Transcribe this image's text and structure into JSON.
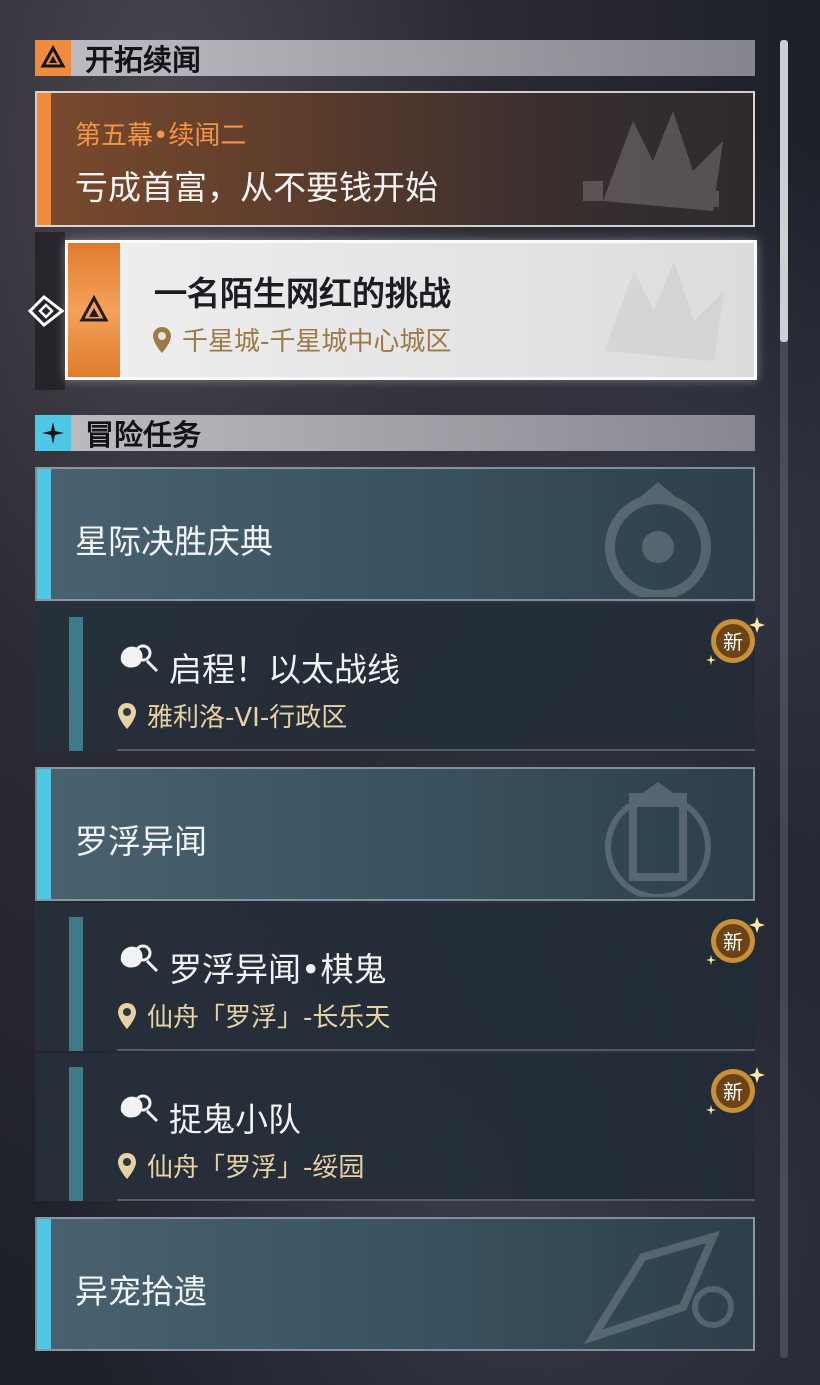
{
  "sections": {
    "trailblaze": {
      "title": "开拓续闻",
      "icon": "trailblaze-icon"
    },
    "adventure": {
      "title": "冒险任务",
      "icon": "adventure-icon"
    }
  },
  "trailblaze_card": {
    "subtitle": "第五幕•续闻二",
    "title": "亏成首富，从不要钱开始"
  },
  "trailblaze_quest": {
    "title": "一名陌生网红的挑战",
    "location": "千星城-千星城中心城区",
    "selected": true
  },
  "groups": [
    {
      "title": "星际决胜庆典"
    },
    {
      "title": "罗浮异闻"
    },
    {
      "title": "异宠拾遗"
    }
  ],
  "quests": [
    {
      "title": "启程！以太战线",
      "location": "雅利洛-VI-行政区",
      "badge": "新"
    },
    {
      "title": "罗浮异闻•棋鬼",
      "location": "仙舟「罗浮」-长乐天",
      "badge": "新"
    },
    {
      "title": "捉鬼小队",
      "location": "仙舟「罗浮」-绥园",
      "badge": "新"
    }
  ],
  "colors": {
    "trailblaze_accent": "#f08a3c",
    "adventure_accent": "#4fc8e6",
    "location_gold": "#e8d2a4",
    "badge_gold": "#c8903a"
  }
}
